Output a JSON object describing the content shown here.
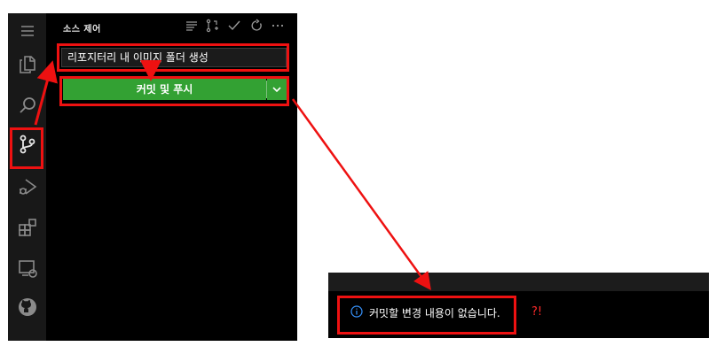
{
  "source_control": {
    "title": "소스 제어",
    "commit_message": "리포지터리 내 이미지 폴더 생성",
    "commit_button": "커밋 및 푸시"
  },
  "notification": {
    "message": "커밋할 변경 내용이 없습니다.",
    "annotation": "?!"
  },
  "icons": {
    "activity_bar": [
      "menu-icon",
      "explorer-icon",
      "search-icon",
      "source-control-icon",
      "run-debug-icon",
      "extensions-icon",
      "remote-explorer-icon",
      "github-icon"
    ],
    "toolbar": [
      "view-as-tree-icon",
      "commit-graph-icon",
      "commit-check-icon",
      "refresh-icon",
      "more-actions-icon"
    ],
    "notification": "info-icon"
  },
  "colors": {
    "commit_button": "#33a133",
    "highlight": "#ee1111",
    "annotation": "#ff2a2a",
    "info_icon": "#3794ff"
  }
}
